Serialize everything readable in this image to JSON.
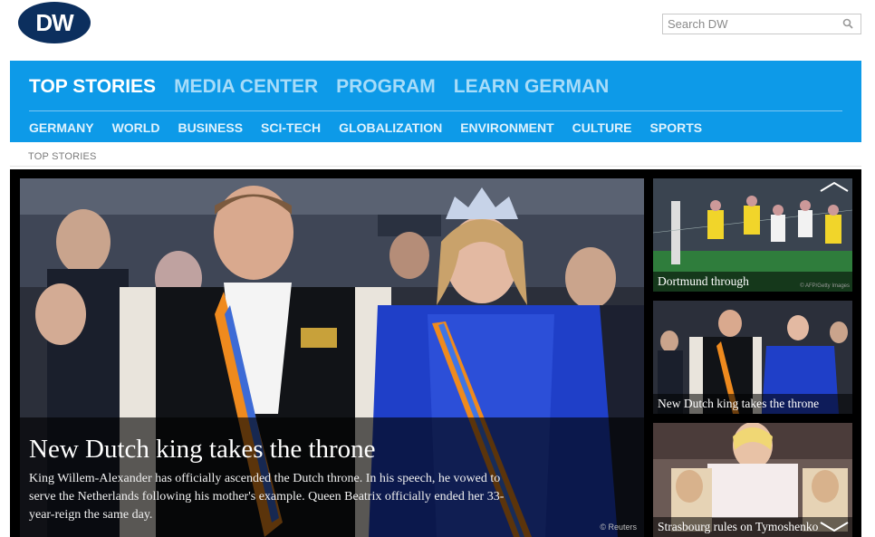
{
  "brand": {
    "logo_text": "DW"
  },
  "search": {
    "placeholder": "Search DW"
  },
  "nav": {
    "primary": [
      {
        "label": "TOP STORIES",
        "active": true
      },
      {
        "label": "MEDIA CENTER",
        "active": false
      },
      {
        "label": "PROGRAM",
        "active": false
      },
      {
        "label": "LEARN GERMAN",
        "active": false
      }
    ],
    "secondary": [
      "GERMANY",
      "WORLD",
      "BUSINESS",
      "SCI-TECH",
      "GLOBALIZATION",
      "ENVIRONMENT",
      "CULTURE",
      "SPORTS"
    ]
  },
  "breadcrumb": "TOP STORIES",
  "hero": {
    "headline": "New Dutch king takes the throne",
    "teaser": "King Willem-Alexander has officially ascended the Dutch throne. In his speech, he vowed to serve the Netherlands following his mother's example. Queen Beatrix officially ended her 33-year-reign the same day.",
    "credit": "© Reuters"
  },
  "thumbnails": [
    {
      "title": "Dortmund through",
      "credit": "© AFP/Getty Images"
    },
    {
      "title": "New Dutch king takes the throne",
      "credit": ""
    },
    {
      "title": "Strasbourg rules on Tymoshenko",
      "credit": ""
    }
  ],
  "colors": {
    "nav_bg": "#0d9ae8",
    "logo_bg": "#0c2f5e",
    "stage_bg": "#000000"
  },
  "icons": {
    "search": "magnifier-icon",
    "up": "chevron-up-icon",
    "down": "chevron-down-icon"
  }
}
